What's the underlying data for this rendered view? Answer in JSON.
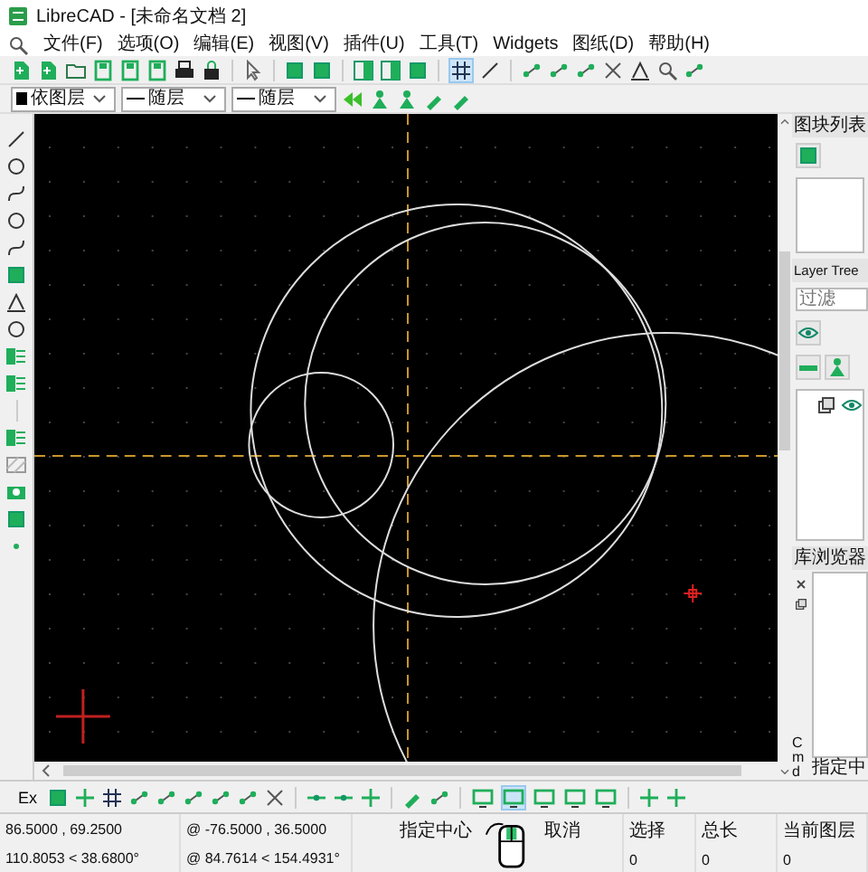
{
  "window": {
    "title": "LibreCAD - [未命名文档 2]"
  },
  "menu": [
    "文件(F)",
    "选项(O)",
    "编辑(E)",
    "视图(V)",
    "插件(U)",
    "工具(T)",
    "Widgets",
    "图纸(D)",
    "帮助(H)"
  ],
  "toolbar": {
    "grid_selected": true
  },
  "pen_toolbar": {
    "color_mode": "依图层",
    "line_type": "随层",
    "line_width": "随层"
  },
  "right_panel": {
    "block_list": {
      "title": "图块列表"
    },
    "layer_tree": {
      "title": "Layer Tree",
      "filter_placeholder": "过滤"
    },
    "library": {
      "title": "库浏览器"
    },
    "command": {
      "label": "Cmd",
      "text": "指定中"
    }
  },
  "snap_toolbar": {
    "label": "Ex"
  },
  "view_buttons": [
    {
      "selected": false
    },
    {
      "selected": true
    },
    {
      "selected": false
    },
    {
      "selected": false
    },
    {
      "selected": false
    }
  ],
  "status": {
    "absolute": [
      "86.5000 , 69.2500",
      "110.8053 < 38.6800°"
    ],
    "relative": [
      "@ -76.5000 , 36.5000",
      "@ 84.7614 < 154.4931°"
    ],
    "mouse_left": "指定中心",
    "mouse_right": "取消",
    "fields": [
      {
        "label": "选择",
        "value": "0"
      },
      {
        "label": "总长",
        "value": "0"
      },
      {
        "label": "当前图层",
        "value": "0"
      }
    ]
  }
}
